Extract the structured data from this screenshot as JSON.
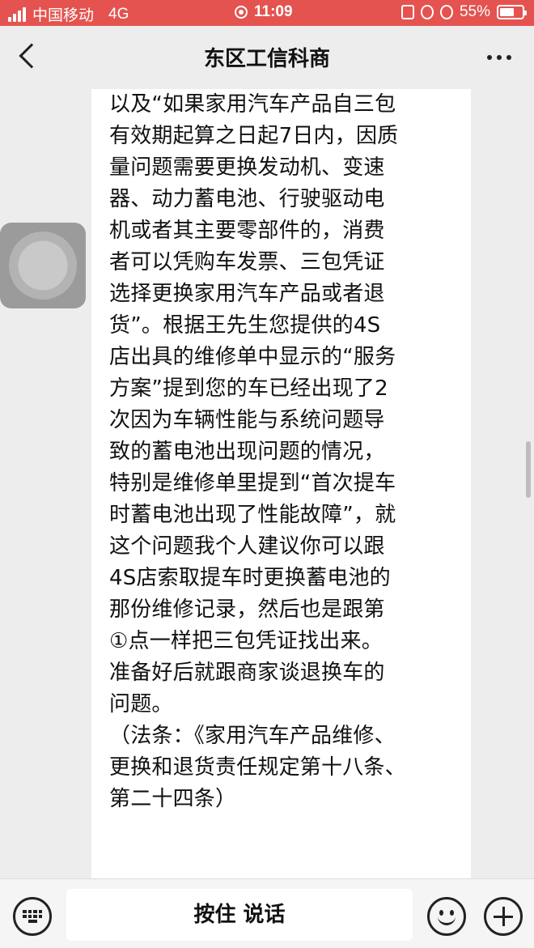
{
  "status_bar": {
    "carrier": "中国移动",
    "network": "4G",
    "time": "11:09",
    "battery": "55%",
    "bg_color": "#e4534f"
  },
  "nav": {
    "title": "东区工信科商",
    "back_icon": "chevron-left-icon",
    "more_icon": "more-dots-icon"
  },
  "chat": {
    "message_text": "以及“如果家用汽车产品自三包\n有效期起算之日起7日内，因质\n量问题需要更换发动机、变速\n器、动力蓄电池、行驶驱动电\n机或者其主要零部件的，消费\n者可以凭购车发票、三包凭证\n选择更换家用汽车产品或者退\n货”。根据王先生您提供的4S\n店出具的维修单中显示的“服务\n方案”提到您的车已经出现了2\n次因为车辆性能与系统问题导\n致的蓄电池出现问题的情况，\n特别是维修单里提到“首次提车\n时蓄电池出现了性能故障”，就\n这个问题我个人建议你可以跟\n4S店索取提车时更换蓄电池的\n那份维修记录，然后也是跟第\n①点一样把三包凭证找出来。\n准备好后就跟商家谈退换车的\n问题。\n （法条：《家用汽车产品维修、\n更换和退货责任规定第十八条、\n第二十四条）"
  },
  "input_bar": {
    "talk_label": "按住 说话",
    "keyboard_icon": "keyboard-icon",
    "emoji_icon": "emoji-icon",
    "plus_icon": "plus-icon"
  }
}
